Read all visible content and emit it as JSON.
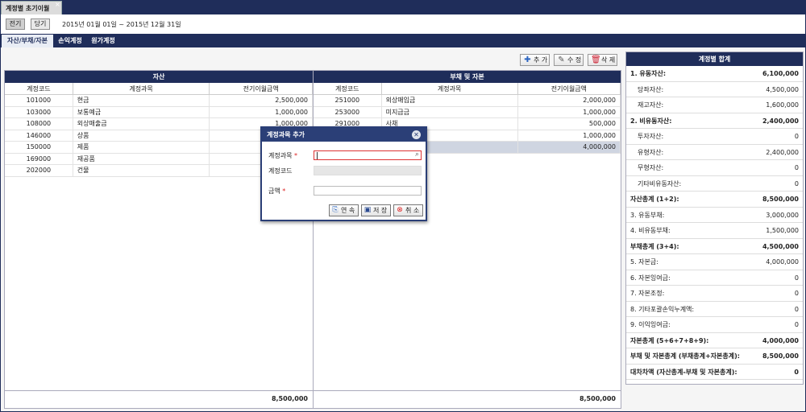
{
  "window": {
    "tab_title": "계정별 초기이월",
    "tab_close": "×"
  },
  "toolbar": {
    "prev_label": "전기",
    "current_label": "당기",
    "period": "2015년 01월 01일 ~ 2015년 12월 31일"
  },
  "tabs": [
    {
      "label": "자산/부채/자본"
    },
    {
      "label": "손익계정"
    },
    {
      "label": "원가계정"
    }
  ],
  "actions": {
    "add": "추 가",
    "edit": "수 정",
    "delete": "삭 제"
  },
  "assets": {
    "title": "자산",
    "columns": [
      "계정코드",
      "계정과목",
      "전기이월금액"
    ],
    "rows": [
      {
        "code": "101000",
        "name": "현금",
        "amount": "2,500,000"
      },
      {
        "code": "103000",
        "name": "보통예금",
        "amount": "1,000,000"
      },
      {
        "code": "108000",
        "name": "외상매출금",
        "amount": "1,000,000"
      },
      {
        "code": "146000",
        "name": "상품",
        "amount": ""
      },
      {
        "code": "150000",
        "name": "제품",
        "amount": ""
      },
      {
        "code": "169000",
        "name": "재공품",
        "amount": ""
      },
      {
        "code": "202000",
        "name": "건물",
        "amount": ""
      }
    ],
    "total": "8,500,000"
  },
  "liabilities": {
    "title": "부채 및 자본",
    "columns": [
      "계정코드",
      "계정과목",
      "전기이월금액"
    ],
    "rows": [
      {
        "code": "251000",
        "name": "외상매입금",
        "amount": "2,000,000"
      },
      {
        "code": "253000",
        "name": "미지급금",
        "amount": "1,000,000"
      },
      {
        "code": "291000",
        "name": "사채",
        "amount": "500,000"
      },
      {
        "code": "",
        "name": "",
        "amount": "1,000,000"
      },
      {
        "code": "",
        "name": "",
        "amount": "4,000,000"
      }
    ],
    "total": "8,500,000"
  },
  "summary": {
    "title": "계정별 합계",
    "rows": [
      {
        "label": "1. 유동자산:",
        "value": "6,100,000"
      },
      {
        "label": "당좌자산:",
        "value": "4,500,000"
      },
      {
        "label": "재고자산:",
        "value": "1,600,000"
      },
      {
        "label": "2. 비유동자산:",
        "value": "2,400,000"
      },
      {
        "label": "투자자산:",
        "value": "0"
      },
      {
        "label": "유형자산:",
        "value": "2,400,000"
      },
      {
        "label": "무형자산:",
        "value": "0"
      },
      {
        "label": "기타비유동자산:",
        "value": "0"
      },
      {
        "label": "자산총계 (1+2):",
        "value": "8,500,000"
      },
      {
        "label": "3. 유동부채:",
        "value": "3,000,000"
      },
      {
        "label": "4. 비유동부채:",
        "value": "1,500,000"
      },
      {
        "label": "부채총계 (3+4):",
        "value": "4,500,000"
      },
      {
        "label": "5. 자본금:",
        "value": "4,000,000"
      },
      {
        "label": "6. 자본잉여금:",
        "value": "0"
      },
      {
        "label": "7. 자본조정:",
        "value": "0"
      },
      {
        "label": "8. 기타포괄손익누계액:",
        "value": "0"
      },
      {
        "label": "9. 이익잉여금:",
        "value": "0"
      },
      {
        "label": "자본총계 (5+6+7+8+9):",
        "value": "4,000,000"
      },
      {
        "label": "부채 및 자본총계 (부채총계+자본총계):",
        "value": "8,500,000"
      },
      {
        "label": "대차차액 (자산총계-부채 및 자본총계):",
        "value": "0"
      }
    ]
  },
  "modal": {
    "title": "계정과목 추가",
    "account_label": "계정과목",
    "code_label": "계정코드",
    "amount_label": "금액",
    "required_mark": "*",
    "account_value": "",
    "code_value": "",
    "amount_value": "",
    "continue_btn": "연 속",
    "save_btn": "저 장",
    "cancel_btn": "취 소"
  },
  "colors": {
    "navy": "#1f2d5a",
    "modal_header": "#2b3f77",
    "required": "#dd2222",
    "selected_row": "#cfd5e1"
  }
}
